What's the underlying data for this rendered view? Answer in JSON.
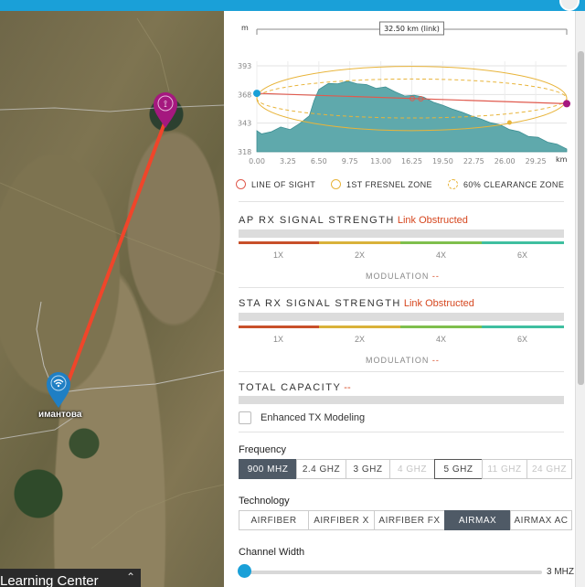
{
  "map": {
    "station_label": "имантова",
    "learning_center": "Learning Center"
  },
  "profile": {
    "y_unit": "m",
    "x_unit": "km",
    "distance_badge": "32.50 km (link)",
    "y_ticks": [
      "393",
      "368",
      "343",
      "318"
    ],
    "x_ticks": [
      "0.00",
      "3.25",
      "6.50",
      "9.75",
      "13.00",
      "16.25",
      "19.50",
      "22.75",
      "26.00",
      "29.25"
    ]
  },
  "chart_data": {
    "type": "area",
    "xlabel": "km",
    "ylabel": "m",
    "xlim": [
      0,
      32.5
    ],
    "ylim": [
      318,
      393
    ],
    "y_ticks": [
      393,
      368,
      343,
      318
    ],
    "x_ticks": [
      0,
      3.25,
      6.5,
      9.75,
      13,
      16.25,
      19.5,
      22.75,
      26,
      29.25
    ],
    "terrain": {
      "x": [
        0,
        0.5,
        1.5,
        2.5,
        3.5,
        4.5,
        5.5,
        6.0,
        6.5,
        7.5,
        8.5,
        9.5,
        10.5,
        11.5,
        12.5,
        13.5,
        14.5,
        15.5,
        16.5,
        17.5,
        18.5,
        19.5,
        20.5,
        21.5,
        22.5,
        23.5,
        24.5,
        25.5,
        26.5,
        27.5,
        28.5,
        29.5,
        30.5,
        31.5,
        32.5
      ],
      "y": [
        337,
        333,
        336,
        339,
        338,
        342,
        350,
        362,
        373,
        377,
        378,
        379,
        378,
        376,
        374,
        374,
        371,
        366,
        368,
        365,
        362,
        358,
        356,
        352,
        350,
        346,
        344,
        341,
        338,
        335,
        332,
        330,
        327,
        324,
        321
      ]
    },
    "line_of_sight": {
      "x": [
        0,
        32.5
      ],
      "y": [
        369,
        360
      ]
    },
    "fresnel_zone": {
      "center_y": 364.5,
      "half_height_m": 28
    },
    "clearance_zone_60": {
      "center_y": 364.5,
      "half_height_m": 17
    },
    "series": [
      {
        "name": "LINE OF SIGHT",
        "color": "#e05a4e"
      },
      {
        "name": "1ST FRESNEL ZONE",
        "color": "#e8b43a"
      },
      {
        "name": "60% CLEARANCE ZONE",
        "color": "#e8b43a"
      }
    ],
    "terrain_color": "#5fa9ac",
    "grid": true
  },
  "legend": {
    "los": "LINE OF SIGHT",
    "fresnel": "1ST FRESNEL ZONE",
    "clearance": "60% CLEARANCE ZONE"
  },
  "ap": {
    "title": "AP RX SIGNAL STRENGTH",
    "status": "Link Obstructed",
    "ticks": [
      "1X",
      "2X",
      "4X",
      "6X"
    ],
    "modulation_label": "MODULATION",
    "modulation_value": "--"
  },
  "sta": {
    "title": "STA RX SIGNAL STRENGTH",
    "status": "Link Obstructed",
    "ticks": [
      "1X",
      "2X",
      "4X",
      "6X"
    ],
    "modulation_label": "MODULATION",
    "modulation_value": "--"
  },
  "capacity": {
    "title": "TOTAL CAPACITY",
    "value": "--"
  },
  "enhanced_tx": {
    "label": "Enhanced TX Modeling",
    "checked": false
  },
  "frequency": {
    "label": "Frequency",
    "options": [
      "900 MHZ",
      "2.4 GHZ",
      "3 GHZ",
      "4 GHZ",
      "5 GHZ",
      "11 GHZ",
      "24 GHZ"
    ],
    "selected": "900 MHZ"
  },
  "technology": {
    "label": "Technology",
    "options": [
      "AIRFIBER",
      "AIRFIBER X",
      "AIRFIBER FX",
      "AIRMAX",
      "AIRMAX AC"
    ],
    "selected": "AIRMAX"
  },
  "channel_width": {
    "label": "Channel Width",
    "value": "3 MHZ"
  },
  "colors": {
    "accent": "#1aa0d8",
    "obstructed": "#d6471f",
    "bar_red": "#c8502a",
    "bar_yellow": "#d9b23a",
    "bar_green": "#7fbf4d",
    "bar_teal": "#3fbfa0",
    "selected_btn": "#4f5a66"
  }
}
